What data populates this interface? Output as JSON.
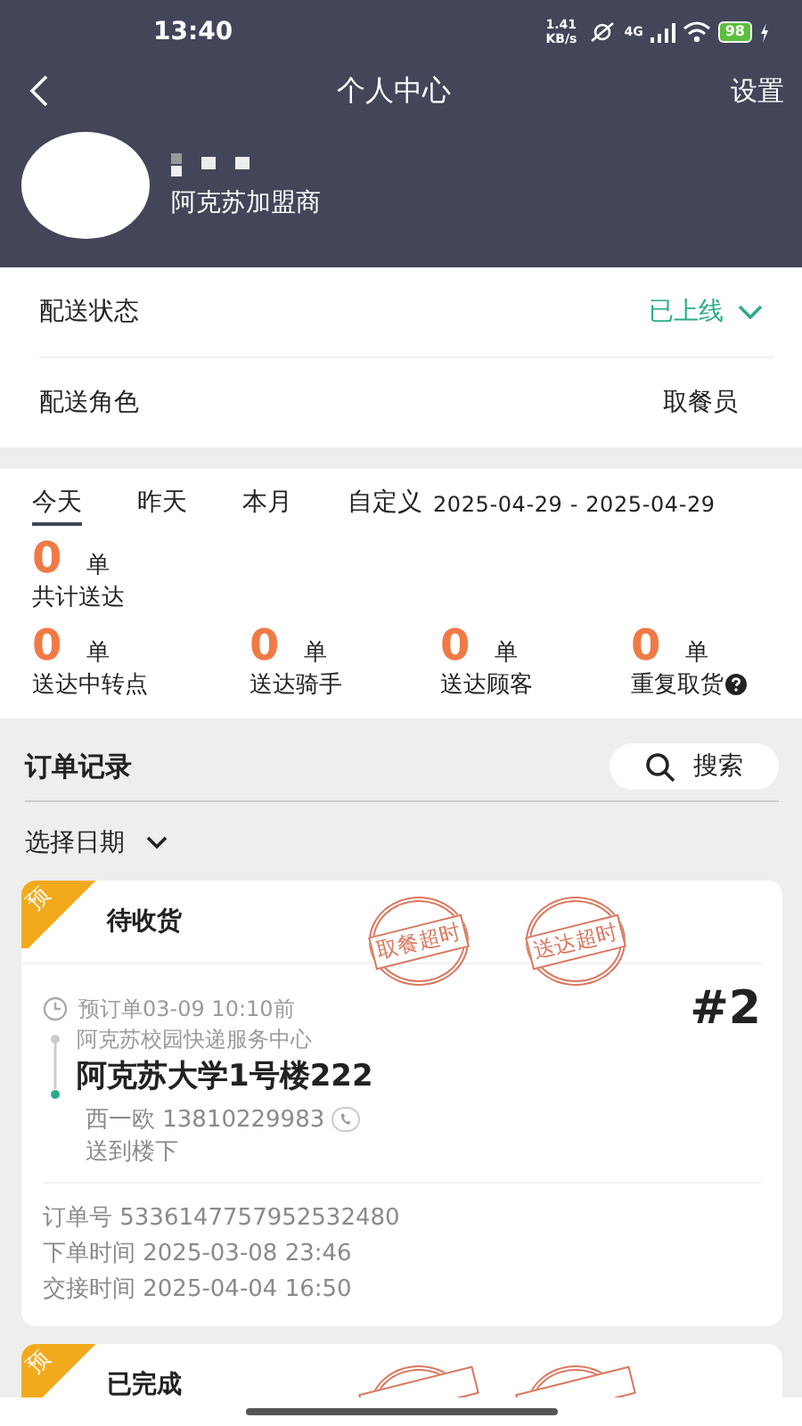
{
  "status_bar": {
    "time": "13:40",
    "speed": "1.41 KB/s",
    "network": "4G",
    "battery": "98"
  },
  "nav": {
    "title": "个人中心",
    "action": "设置"
  },
  "profile": {
    "org": "阿克苏加盟商"
  },
  "settings": [
    {
      "label": "配送状态",
      "value": "已上线",
      "kind": "dropdown"
    },
    {
      "label": "配送角色",
      "value": "取餐员",
      "kind": "plain"
    }
  ],
  "period_tabs": [
    {
      "label": "今天",
      "selected": true
    },
    {
      "label": "昨天",
      "selected": false
    },
    {
      "label": "本月",
      "selected": false
    },
    {
      "label": "自定义",
      "selected": false
    }
  ],
  "date_range": "2025-04-29 - 2025-04-29",
  "total": {
    "value": "0",
    "unit": "单",
    "label": "共计送达"
  },
  "breakdown": [
    {
      "value": "0",
      "unit": "单",
      "label": "送达中转点",
      "kind": "plain"
    },
    {
      "value": "0",
      "unit": "单",
      "label": "送达骑手",
      "kind": "plain"
    },
    {
      "value": "0",
      "unit": "单",
      "label": "送达顾客",
      "kind": "plain"
    },
    {
      "value": "0",
      "unit": "单",
      "label": "重复取货",
      "kind": "help"
    }
  ],
  "orders": {
    "title": "订单记录",
    "search": "搜索",
    "date_filter": "选择日期"
  },
  "cards": [
    {
      "tag": "预",
      "status": "待收货",
      "stamps": [
        {
          "kind": "full",
          "text": "取餐超时"
        },
        {
          "kind": "full",
          "text": "送达超时"
        }
      ],
      "reserve": "预订单03-09 10:10前",
      "from": "阿克苏校园快递服务中心",
      "to": "阿克苏大学1号楼222",
      "contact": "西一欧 13810229983",
      "note": "送到楼下",
      "number": "#2",
      "details": [
        "订单号 5336147757952532480",
        "下单时间 2025-03-08 23:46",
        "交接时间 2025-04-04 16:50"
      ]
    },
    {
      "tag": "预",
      "status": "已完成",
      "stamps": [
        {
          "kind": "partial"
        },
        {
          "kind": "partial"
        }
      ]
    }
  ]
}
